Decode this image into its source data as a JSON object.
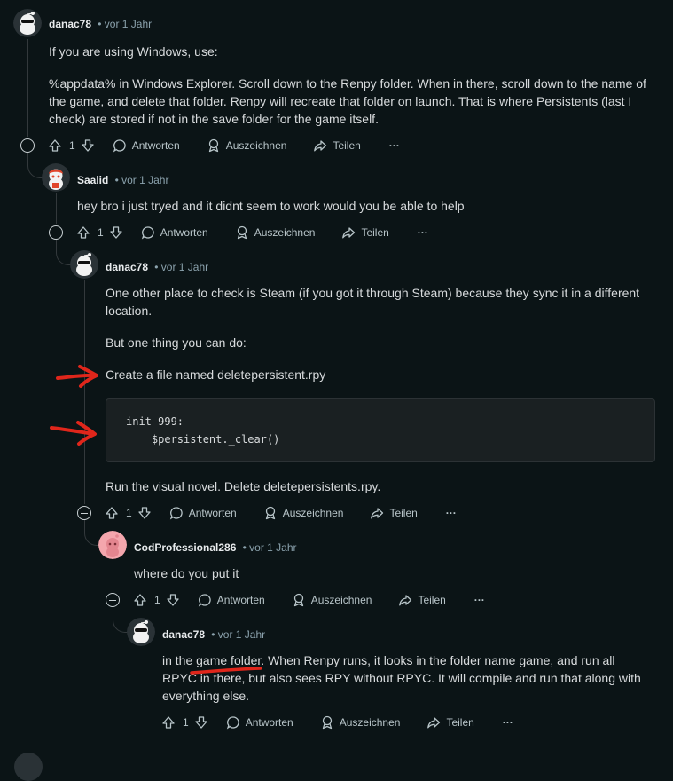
{
  "labels": {
    "reply": "Antworten",
    "award": "Auszeichnen",
    "share": "Teilen",
    "more": "···"
  },
  "colors": {
    "background": "#0b1416",
    "thread_line": "#33393c",
    "annotation_red": "#e0261b",
    "codeblock_bg": "#1a2022"
  },
  "comments": [
    {
      "author": "danac78",
      "time": "vor 1 Jahr",
      "avatar": "snoo-sunglasses-avatar",
      "paragraphs": [
        "If you are using Windows, use:",
        "%appdata% in Windows Explorer. Scroll down to the Renpy folder. When in there, scroll down to the name of the game, and delete that folder. Renpy will recreate that folder on launch. That is where Persistents (last I check) are stored if not in the save folder for the game itself."
      ],
      "votes": "1"
    },
    {
      "author": "Saalid",
      "time": "vor 1 Jahr",
      "avatar": "snoo-red-hair-avatar",
      "paragraphs": [
        "hey bro i just tryed and it didnt seem to work would you be able to help"
      ],
      "votes": "1"
    },
    {
      "author": "danac78",
      "time": "vor 1 Jahr",
      "avatar": "snoo-sunglasses-avatar",
      "paragraphs": [
        "One other place to check is Steam (if you got it through Steam) because they sync it in a different location.",
        "But one thing you can do:",
        "Create a file named deletepersistent.rpy"
      ],
      "code": [
        "init 999:",
        "    $persistent._clear()"
      ],
      "after_code": "Run the visual novel. Delete deletepersistents.rpy.",
      "votes": "1"
    },
    {
      "author": "CodProfessional286",
      "time": "vor 1 Jahr",
      "avatar": "snoo-pink-avatar",
      "paragraphs": [
        "where do you put it"
      ],
      "votes": "1"
    },
    {
      "author": "danac78",
      "time": "vor 1 Jahr",
      "avatar": "snoo-sunglasses-avatar",
      "paragraphs": [
        "in the game folder. When Renpy runs, it looks in the folder name game, and run all RPYC in there, but also sees RPY without RPYC. It will compile and run that along with everything else."
      ],
      "votes": "1"
    }
  ]
}
